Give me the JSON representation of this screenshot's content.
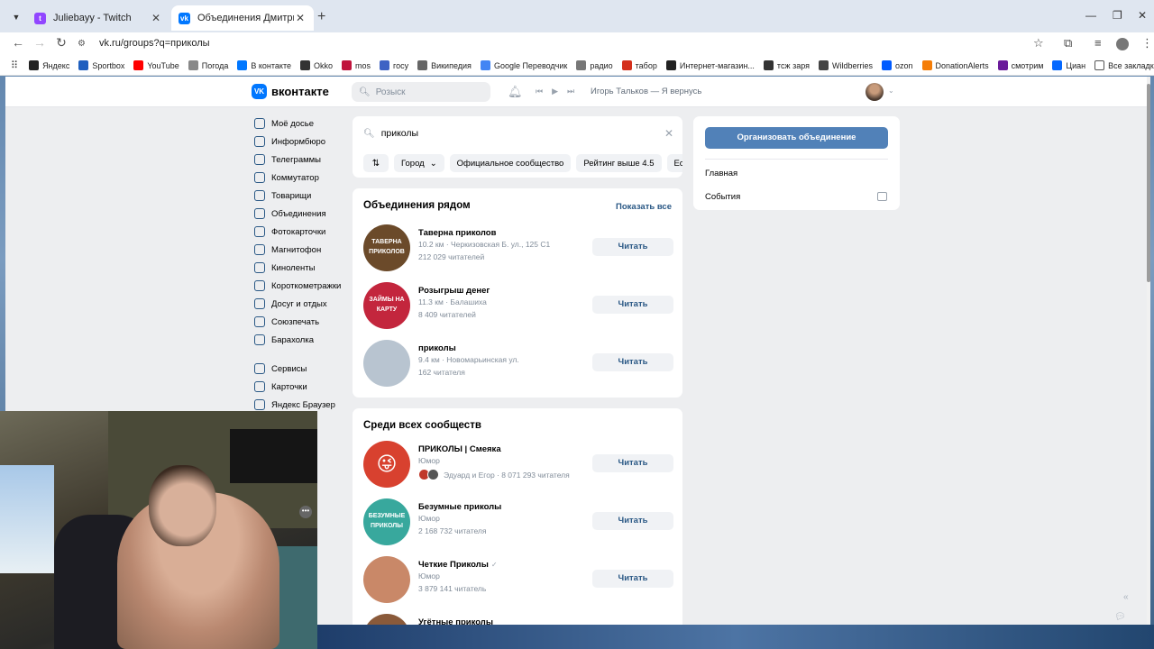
{
  "browser": {
    "tabs": [
      {
        "title": "Juliebayy - Twitch",
        "favicon_color": "#9146ff",
        "favicon_glyph": "t",
        "active": false
      },
      {
        "title": "Объединения Дмитрия Зорин",
        "favicon_color": "#0077ff",
        "favicon_glyph": "vk",
        "active": true
      }
    ],
    "new_tab_icon": "plus-icon",
    "url": "vk.ru/groups?q=приколы",
    "bookmarks": [
      {
        "label": "Яндекс",
        "color": "#222"
      },
      {
        "label": "Sportbox",
        "color": "#1f5fbf"
      },
      {
        "label": "YouTube",
        "color": "#ff0000"
      },
      {
        "label": "Погода",
        "color": "#888"
      },
      {
        "label": "В контакте",
        "color": "#0077ff"
      },
      {
        "label": "Okko",
        "color": "#333"
      },
      {
        "label": "mos",
        "color": "#c0143c"
      },
      {
        "label": "госу",
        "color": "#3e62c4"
      },
      {
        "label": "Википедия",
        "color": "#666"
      },
      {
        "label": "Google Переводчик",
        "color": "#4285f4"
      },
      {
        "label": "радио",
        "color": "#777"
      },
      {
        "label": "табор",
        "color": "#d4301c"
      },
      {
        "label": "Интернет-магазин...",
        "color": "#222"
      },
      {
        "label": "тсж заря",
        "color": "#333"
      },
      {
        "label": "Wildberries",
        "color": "#444"
      },
      {
        "label": "ozon",
        "color": "#005bff"
      },
      {
        "label": "DonationAlerts",
        "color": "#f57d07"
      },
      {
        "label": "смотрим",
        "color": "#6a1b9a"
      },
      {
        "label": "Циан",
        "color": "#0468ff"
      }
    ],
    "all_bookmarks": "Все закладки"
  },
  "vk": {
    "logo": "вконтакте",
    "search_placeholder": "Розыск",
    "now_playing": "Игорь Тальков — Я вернусь",
    "left_nav": [
      {
        "label": "Моё досье",
        "icon": "user-icon"
      },
      {
        "label": "Информбюро",
        "icon": "news-icon"
      },
      {
        "label": "Телеграммы",
        "icon": "messages-icon"
      },
      {
        "label": "Коммутатор",
        "icon": "phone-icon"
      },
      {
        "label": "Товарищи",
        "icon": "friends-icon"
      },
      {
        "label": "Объединения",
        "icon": "groups-icon"
      },
      {
        "label": "Фотокарточки",
        "icon": "photos-icon"
      },
      {
        "label": "Магнитофон",
        "icon": "music-icon"
      },
      {
        "label": "Киноленты",
        "icon": "video-icon"
      },
      {
        "label": "Короткометражки",
        "icon": "clips-icon"
      },
      {
        "label": "Досуг и отдых",
        "icon": "games-icon"
      },
      {
        "label": "Союзпечать",
        "icon": "stickers-icon"
      },
      {
        "label": "Барахолка",
        "icon": "market-icon"
      }
    ],
    "left_nav_extra": [
      {
        "label": "Сервисы",
        "icon": "services-icon"
      },
      {
        "label": "Карточки",
        "icon": "cards-icon"
      },
      {
        "label": "Яндекс Браузер",
        "icon": "yandex-icon"
      }
    ],
    "search": {
      "query": "приколы",
      "filters": [
        "Город",
        "Официальное сообщество",
        "Рейтинг выше 4.5",
        "Есть"
      ]
    },
    "nearby": {
      "title": "Объединения рядом",
      "show_all": "Показать все",
      "groups": [
        {
          "name": "Таверна приколов",
          "line2": "10.2 км · Черкизовская Б. ул., 125 С1",
          "line3": "212 029 читателей",
          "button": "Читать",
          "avatar_bg": "#6b4a2a",
          "avatar_text": "ТАВЕРНА ПРИКОЛОВ"
        },
        {
          "name": "Розыгрыш денег",
          "line2": "11.3 км · Балашиха",
          "line3": "8 409 читателей",
          "button": "Читать",
          "avatar_bg": "#c3263d",
          "avatar_text": "ЗАЙМЫ НА КАРТУ"
        },
        {
          "name": "приколы",
          "line2": "9.4 км · Новомарьинская ул.",
          "line3": "162 читателя",
          "button": "Читать",
          "avatar_bg": "#b8c4d0",
          "avatar_text": ""
        }
      ]
    },
    "all": {
      "title": "Среди всех сообществ",
      "groups": [
        {
          "name": "ПРИКОЛЫ | Смеяка",
          "line2": "Юмор",
          "line3": "Эдуард и Егор · 8 071 293 читателя",
          "button": "Читать",
          "avatar_bg": "#d8412f",
          "avatar_text": "😜",
          "friends": true,
          "verified": false
        },
        {
          "name": "Безумные приколы",
          "line2": "Юмор",
          "line3": "2 168 732 читателя",
          "button": "Читать",
          "avatar_bg": "#38a89d",
          "avatar_text": "БЕЗУМНЫЕ ПРИКОЛЫ",
          "friends": false,
          "verified": false
        },
        {
          "name": "Четкие Приколы",
          "line2": "Юмор",
          "line3": "3 879 141 читатель",
          "button": "Читать",
          "avatar_bg": "#c98868",
          "avatar_text": "",
          "friends": false,
          "verified": true
        },
        {
          "name": "Угётные приколы",
          "line2": "",
          "line3": "",
          "button": "",
          "avatar_bg": "#8a5a3a",
          "avatar_text": "",
          "friends": false,
          "verified": false
        }
      ]
    },
    "right": {
      "create_button": "Организовать объединение",
      "menu": [
        "Главная",
        "События"
      ]
    }
  }
}
